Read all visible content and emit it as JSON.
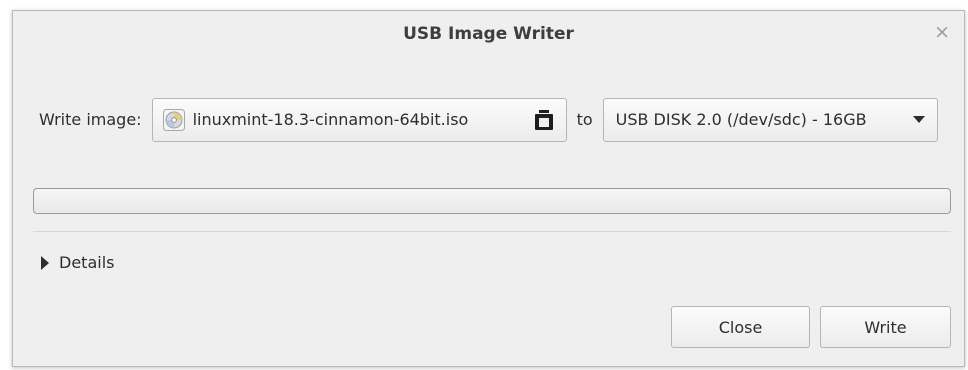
{
  "window": {
    "title": "USB Image Writer",
    "close_glyph": "×"
  },
  "form": {
    "write_image_label": "Write image:",
    "file_name": "linuxmint-18.3-cinnamon-64bit.iso",
    "file_icon": "disc-icon",
    "open_icon": "file-open-icon",
    "to_label": "to",
    "device": "USB DISK 2.0 (/dev/sdc) - 16GB"
  },
  "progress": {
    "value": 0
  },
  "details": {
    "label": "Details",
    "expanded": false
  },
  "actions": {
    "close_label": "Close",
    "write_label": "Write"
  }
}
